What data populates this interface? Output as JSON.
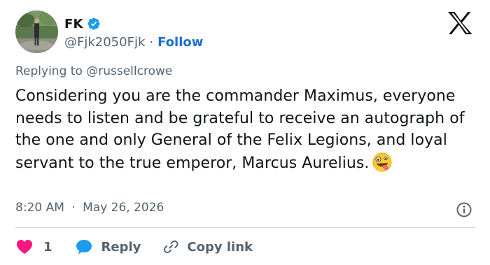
{
  "author": {
    "display_name": "FK",
    "handle": "@Fjk2050Fjk",
    "separator": "·",
    "follow_label": "Follow"
  },
  "reply_context": "Replying to @russellcrowe",
  "tweet": {
    "text": "Considering you are the commander Maximus, everyone needs to listen and be grateful to receive an autograph of the one and only General of the Felix Legions, and loyal servant to the true emperor, Marcus Aurelius.",
    "emoji": "zany-face-emoji"
  },
  "meta": {
    "time": "8:20 AM",
    "separator": "·",
    "date": "May 26, 2026"
  },
  "actions": {
    "like_count": "1",
    "reply_label": "Reply",
    "copy_label": "Copy link"
  },
  "icons": {
    "verified": "verified-badge-icon",
    "brand": "x-logo-icon",
    "info": "info-icon",
    "like": "heart-icon",
    "reply": "speech-bubble-icon",
    "copy": "link-icon"
  },
  "colors": {
    "text": "#0f1419",
    "secondary": "#536471",
    "follow": "#1d6fcd",
    "verified": "#1d9bf0",
    "like": "#f91880",
    "reply": "#1d9bf0",
    "divider": "#cfd9de"
  }
}
